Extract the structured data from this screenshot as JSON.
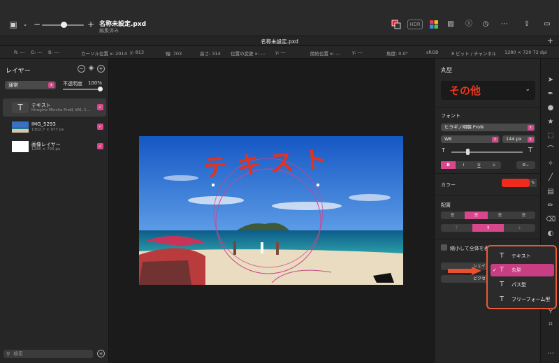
{
  "titlebar": {
    "doc_title": "名称未設定.pxd",
    "doc_status": "編集済み",
    "zoom_minus": "−",
    "zoom_plus": "+",
    "hdr": "HDR"
  },
  "tab": {
    "title": "名称未設定.pxd",
    "plus": "+"
  },
  "info": {
    "r": "R: ---",
    "g": "G: ---",
    "b": "B: ---",
    "cursor_x": "カーソル位置 x: 2014",
    "cursor_y": "y: 813",
    "width": "幅: 703",
    "height": "高さ: 314",
    "change_x": "位置の変更 x: ---",
    "change_y": "y: ---",
    "start_x": "開始位置 x: ---",
    "start_y": "y: ---",
    "angle": "角度: 0.0°",
    "colorspace": "sRGB",
    "depth": "8 ビット / チャンネル",
    "size": "1280 × 720 72 dpi"
  },
  "layers": {
    "title": "レイヤー",
    "blend_mode": "通常",
    "opacity_label": "不透明度",
    "opacity_value": "100%",
    "opacity": 1.0,
    "items": [
      {
        "name": "テキスト",
        "sub": "Hiragino Mincho ProN, W6, 1...",
        "selected": true,
        "visible": true
      },
      {
        "name": "IMG_5293",
        "sub": "1302.7 × 977 px",
        "selected": false,
        "visible": true
      },
      {
        "name": "画像レイヤー",
        "sub": "1280 × 720 px",
        "selected": false,
        "visible": true
      }
    ],
    "search_placeholder": "検索"
  },
  "canvas": {
    "text": "テキスト",
    "text_color": "#e5321f"
  },
  "right_panel": {
    "title": "丸型",
    "style_name": "その他",
    "font_label": "フォント",
    "font_family": "ヒラギノ明朝 ProN",
    "font_weight": "W6",
    "font_size": "144 px",
    "bold": "B",
    "italic": "I",
    "underline": "U",
    "strike": "S",
    "gear": "⚙⌄",
    "color_label": "カラー",
    "color_value": "#ef2b1d",
    "align_label": "配置",
    "shrink_label": "縮小して全体を表示",
    "btn1": "シェイ",
    "btn2": "ピクセ"
  },
  "popup": {
    "items": [
      {
        "label": "テキスト",
        "selected": false
      },
      {
        "label": "丸型",
        "selected": true
      },
      {
        "label": "パス型",
        "selected": false
      },
      {
        "label": "フリーフォーム型",
        "selected": false
      }
    ]
  },
  "colors": {
    "accent": "#d8478b",
    "highlight_border": "#e85a35"
  }
}
